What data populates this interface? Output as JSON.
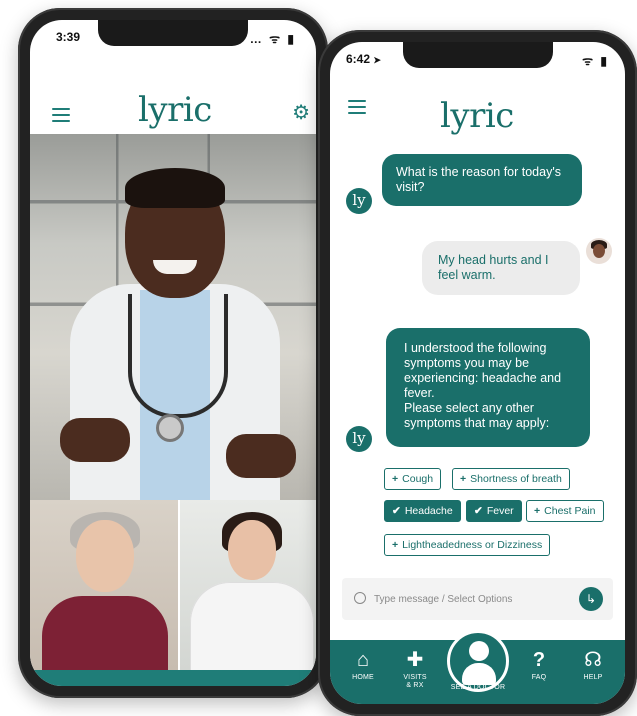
{
  "left_phone": {
    "status_time": "3:39",
    "status_icons": "… ᯤ ▮",
    "logo": "lyric",
    "menu_icon": "hamburger-icon",
    "settings_icon": "gear-icon"
  },
  "right_phone": {
    "status_time": "6:42",
    "status_arrow": "➤",
    "status_icons": "ᯤ ▮",
    "logo": "lyric",
    "bot_avatar": "ly",
    "messages": [
      {
        "from": "bot",
        "text": "What is the reason for today's visit?"
      },
      {
        "from": "user",
        "text": "My head hurts and I feel warm."
      },
      {
        "from": "bot",
        "lines": [
          "I understood the following symptoms you may be experiencing: headache and fever.",
          "Please select any other symptoms that may apply:"
        ]
      }
    ],
    "chips": [
      {
        "label": "Cough",
        "prefix": "+",
        "selected": false
      },
      {
        "label": "Shortness of breath",
        "prefix": "+",
        "selected": false
      },
      {
        "label": "Headache",
        "prefix": "✔",
        "selected": true
      },
      {
        "label": "Fever",
        "prefix": "✔",
        "selected": true
      },
      {
        "label": "Chest Pain",
        "prefix": "+",
        "selected": false
      },
      {
        "label": "Lightheadedness or Dizziness",
        "prefix": "+",
        "selected": false
      }
    ],
    "composer": {
      "placeholder": "Type message / Select Options",
      "send_glyph": "↳"
    },
    "tabs": [
      {
        "label": "HOME",
        "icon": "⌂"
      },
      {
        "label_line1": "VISITS",
        "label_line2": "& RX",
        "icon": "✚"
      },
      {
        "label": "SEE A DOCTOR",
        "icon": "doctor-icon"
      },
      {
        "label": "FAQ",
        "icon": "?"
      },
      {
        "label": "HELP",
        "icon": "☊"
      }
    ]
  },
  "colors": {
    "brand_teal": "#1a6f6a",
    "bubble_user_bg": "#ececec"
  }
}
